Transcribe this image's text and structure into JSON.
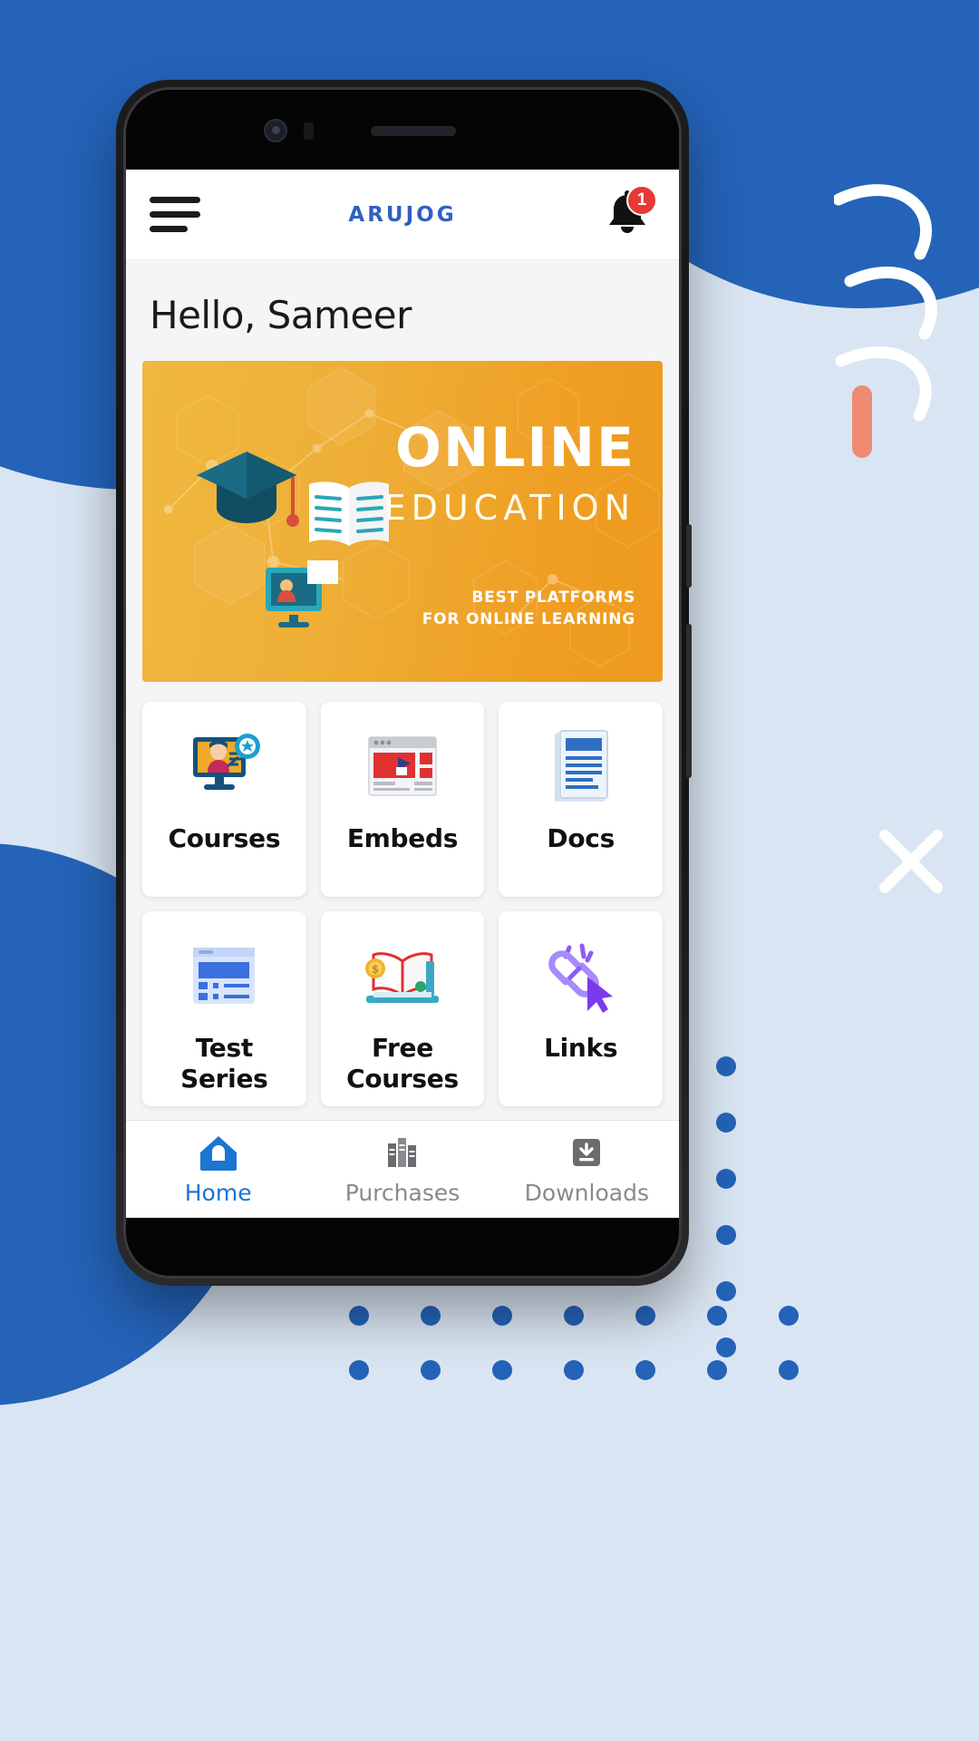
{
  "app": {
    "brand": "ARUJOG",
    "menu_icon": "hamburger-menu-icon",
    "notification_icon": "bell-icon",
    "notification_count": "1",
    "accent_blue": "#2f5fc4",
    "badge_red": "#e53935",
    "active_nav_color": "#1976d2"
  },
  "greeting": "Hello, Sameer",
  "banner": {
    "title": "ONLINE",
    "subtitle": "EDUCATION",
    "tagline_line1": "BEST PLATFORMS",
    "tagline_line2": "FOR ONLINE LEARNING",
    "bg_color_start": "#f0b840",
    "bg_color_end": "#ee9a1e"
  },
  "grid": {
    "items": [
      {
        "label": "Courses",
        "icon": "online-course-monitor-icon"
      },
      {
        "label": "Embeds",
        "icon": "browser-video-embed-icon"
      },
      {
        "label": "Docs",
        "icon": "document-page-icon"
      },
      {
        "label": "Test\nSeries",
        "label_l1": "Test",
        "label_l2": "Series",
        "icon": "test-list-window-icon"
      },
      {
        "label": "Free\nCourses",
        "label_l1": "Free",
        "label_l2": "Courses",
        "icon": "open-book-coin-icon"
      },
      {
        "label": "Links",
        "icon": "link-cursor-icon"
      }
    ]
  },
  "bottom_nav": {
    "items": [
      {
        "label": "Home",
        "icon": "home-icon",
        "active": true
      },
      {
        "label": "Purchases",
        "icon": "books-icon",
        "active": false
      },
      {
        "label": "Downloads",
        "icon": "download-icon",
        "active": false
      }
    ]
  }
}
